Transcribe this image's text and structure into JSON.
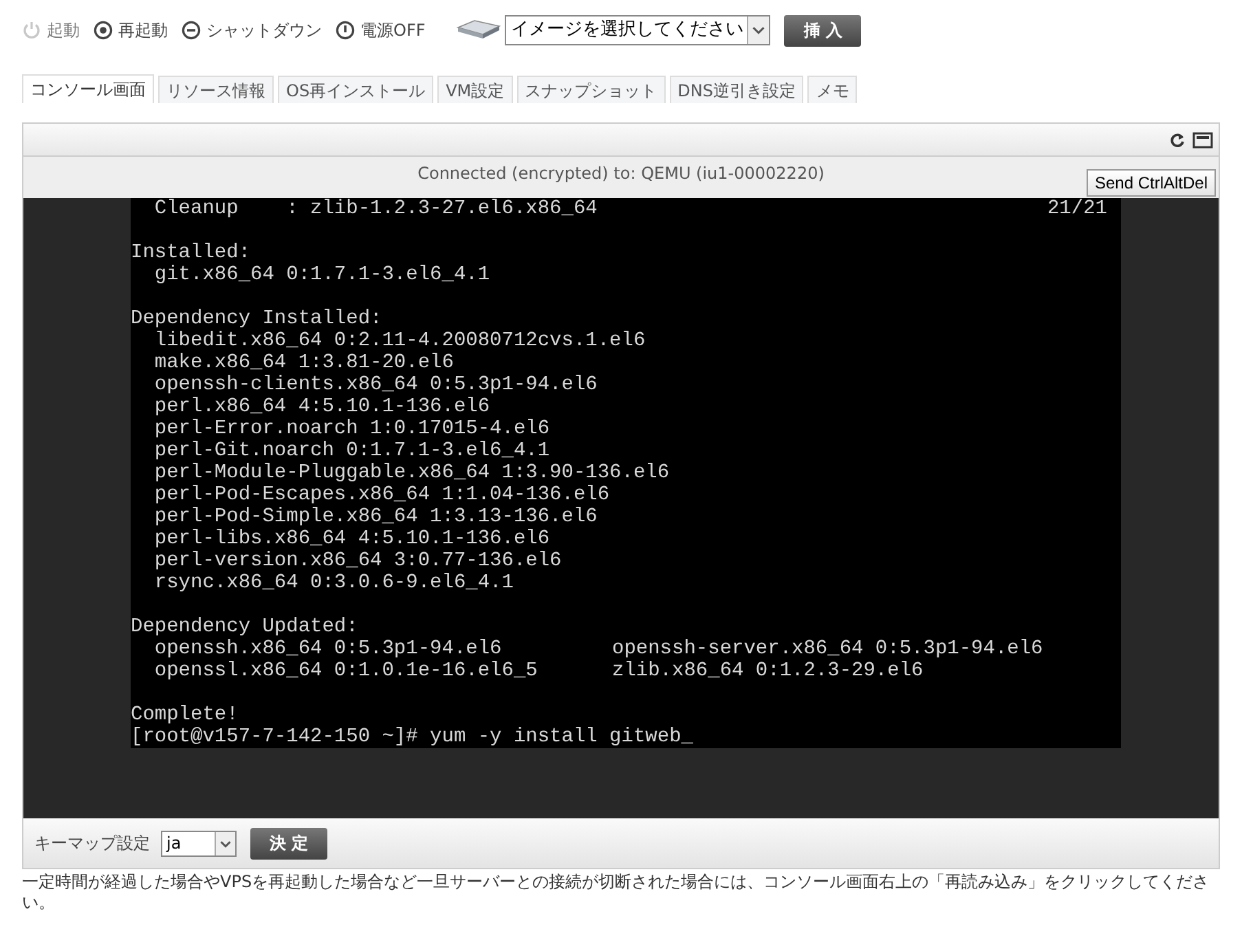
{
  "power_actions": [
    {
      "kind": "start",
      "label": "起動",
      "disabled": true
    },
    {
      "kind": "restart",
      "label": "再起動",
      "disabled": false
    },
    {
      "kind": "shutdown",
      "label": "シャットダウン",
      "disabled": false
    },
    {
      "kind": "poweroff",
      "label": "電源OFF",
      "disabled": false
    }
  ],
  "image_select": {
    "value": "イメージを選択してください"
  },
  "insert_button": "挿 入",
  "tabs": [
    {
      "label": "コンソール画面",
      "selected": true
    },
    {
      "label": "リソース情報",
      "selected": false
    },
    {
      "label": "OS再インストール",
      "selected": false
    },
    {
      "label": "VM設定",
      "selected": false
    },
    {
      "label": "スナップショット",
      "selected": false
    },
    {
      "label": "DNS逆引き設定",
      "selected": false
    },
    {
      "label": "メモ",
      "selected": false
    }
  ],
  "console": {
    "status": "Connected (encrypted) to: QEMU (iu1-00002220)",
    "send_button": "Send CtrlAltDel",
    "blocks": [
      [
        {
          "kind": "split",
          "text": "  Cleanup    : zlib-1.2.3-27.el6.x86_64",
          "right": "21/21"
        }
      ],
      [
        {
          "kind": "line",
          "text": "Installed:"
        },
        {
          "kind": "line",
          "text": "  git.x86_64 0:1.7.1-3.el6_4.1"
        }
      ],
      [
        {
          "kind": "line",
          "text": "Dependency Installed:"
        },
        {
          "kind": "line",
          "text": "  libedit.x86_64 0:2.11-4.20080712cvs.1.el6"
        },
        {
          "kind": "line",
          "text": "  make.x86_64 1:3.81-20.el6"
        },
        {
          "kind": "line",
          "text": "  openssh-clients.x86_64 0:5.3p1-94.el6"
        },
        {
          "kind": "line",
          "text": "  perl.x86_64 4:5.10.1-136.el6"
        },
        {
          "kind": "line",
          "text": "  perl-Error.noarch 1:0.17015-4.el6"
        },
        {
          "kind": "line",
          "text": "  perl-Git.noarch 0:1.7.1-3.el6_4.1"
        },
        {
          "kind": "line",
          "text": "  perl-Module-Pluggable.x86_64 1:3.90-136.el6"
        },
        {
          "kind": "line",
          "text": "  perl-Pod-Escapes.x86_64 1:1.04-136.el6"
        },
        {
          "kind": "line",
          "text": "  perl-Pod-Simple.x86_64 1:3.13-136.el6"
        },
        {
          "kind": "line",
          "text": "  perl-libs.x86_64 4:5.10.1-136.el6"
        },
        {
          "kind": "line",
          "text": "  perl-version.x86_64 3:0.77-136.el6"
        },
        {
          "kind": "line",
          "text": "  rsync.x86_64 0:3.0.6-9.el6_4.1"
        }
      ],
      [
        {
          "kind": "line",
          "text": "Dependency Updated:"
        },
        {
          "kind": "columns",
          "columns": [
            "  openssh.x86_64 0:5.3p1-94.el6",
            "openssh-server.x86_64 0:5.3p1-94.el6"
          ]
        },
        {
          "kind": "columns",
          "columns": [
            "  openssl.x86_64 0:1.0.1e-16.el6_5",
            "zlib.x86_64 0:1.2.3-29.el6"
          ]
        }
      ],
      [
        {
          "kind": "line",
          "text": "Complete!"
        },
        {
          "kind": "line",
          "text": "[root@v157-7-142-150 ~]# yum -y install gitweb_"
        }
      ]
    ]
  },
  "keymap": {
    "label": "キーマップ設定",
    "value": "ja",
    "button": "決 定"
  },
  "note": "一定時間が経過した場合やVPSを再起動した場合など一旦サーバーとの接続が切断された場合には、コンソール画面右上の「再読み込み」をクリックしてください。"
}
